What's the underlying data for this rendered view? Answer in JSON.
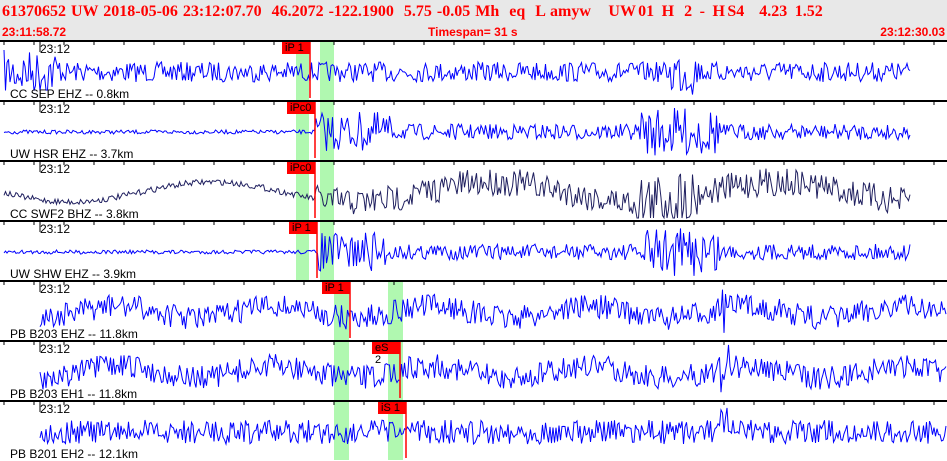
{
  "header": {
    "title": "61370652  UW  2018-05-06  23:12:07.70    46.2072  -122.1900    5.75  -0.05  Mh    eq    L  amyw       UW 01   H    2   -   H S4      4.23   1.52",
    "start_time": "23:11:58.72",
    "timespan": "Timespan=  31 s",
    "end_time": "23:12:30.03"
  },
  "colors": {
    "header_text": "#ff0000",
    "trace": "#0000ff",
    "trace_dark": "#202060",
    "pick": "#ff0000",
    "window": "#b0f8b0"
  },
  "panels": [
    {
      "station": "CC SEP EHZ -- 0.8km",
      "time": "23:12",
      "pick": "iP 1"
    },
    {
      "station": "UW HSR EHZ -- 3.7km",
      "time": "23:12",
      "pick": "iPc0"
    },
    {
      "station": "CC SWF2 BHZ -- 3.8km",
      "time": "23:12",
      "pick": "iPc0"
    },
    {
      "station": "UW SHW EHZ -- 3.9km",
      "time": "23:12",
      "pick": "iP 1"
    },
    {
      "station": "PB B203 EHZ -- 11.8km",
      "time": "23:12",
      "pick": "iP 1"
    },
    {
      "station": "PB B203 EH1 -- 11.8km",
      "time": "23:12",
      "pick": "eS 2"
    },
    {
      "station": "PB B201 EH2 -- 12.1km",
      "time": "23:12",
      "pick": "iS 1"
    }
  ]
}
